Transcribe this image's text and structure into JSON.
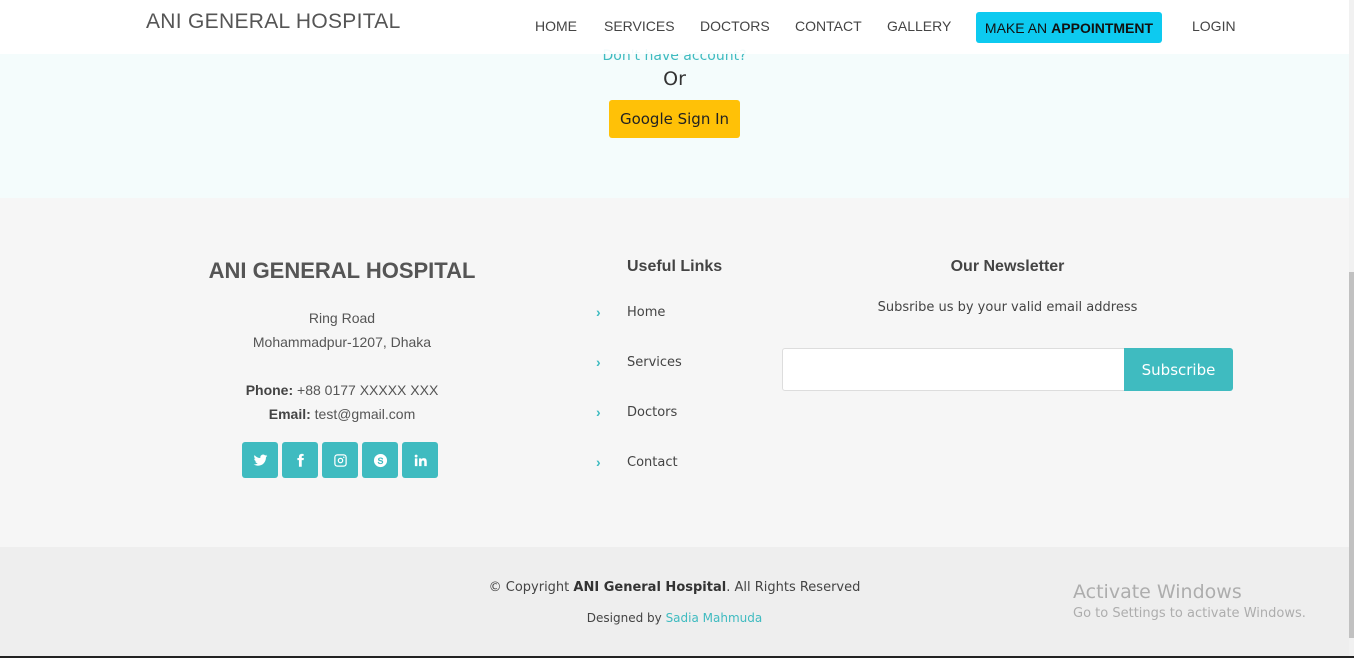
{
  "login": {
    "no_account": "Don't have account?",
    "or": "Or",
    "google_sign_in": "Google Sign In"
  },
  "header": {
    "logo": "ANI GENERAL HOSPITAL",
    "nav": [
      "HOME",
      "SERVICES",
      "DOCTORS",
      "CONTACT",
      "GALLERY"
    ],
    "appointment_prefix": "MAKE AN",
    "appointment_bold": "APPOINTMENT",
    "login": "LOGIN"
  },
  "footer": {
    "hospital_name": "ANI GENERAL HOSPITAL",
    "address_line1": "Ring Road",
    "address_line2": "Mohammadpur-1207, Dhaka",
    "phone_label": "Phone:",
    "phone_value": "+88 0177 XXXXX XXX",
    "email_label": "Email:",
    "email_value": "test@gmail.com",
    "socials": [
      "twitter-icon",
      "facebook-icon",
      "instagram-icon",
      "skype-icon",
      "linkedin-icon"
    ],
    "useful_links_title": "Useful Links",
    "useful_links": [
      "Home",
      "Services",
      "Doctors",
      "Contact"
    ],
    "newsletter_title": "Our Newsletter",
    "newsletter_sub": "Subsribe us by your valid email address",
    "newsletter_input_value": "",
    "subscribe_label": "Subscribe",
    "copyright_prefix": "© Copyright",
    "copyright_brand": "ANI General Hospital",
    "copyright_suffix": ". All Rights Reserved",
    "designed_by": "Designed by",
    "designer": "Sadia Mahmuda"
  },
  "windows_watermark": {
    "line1": "Activate Windows",
    "line2": "Go to Settings to activate Windows."
  },
  "colors": {
    "accent": "#3fbbc0",
    "appointment_bg": "#0dcaf0",
    "google_btn": "#ffc107"
  }
}
